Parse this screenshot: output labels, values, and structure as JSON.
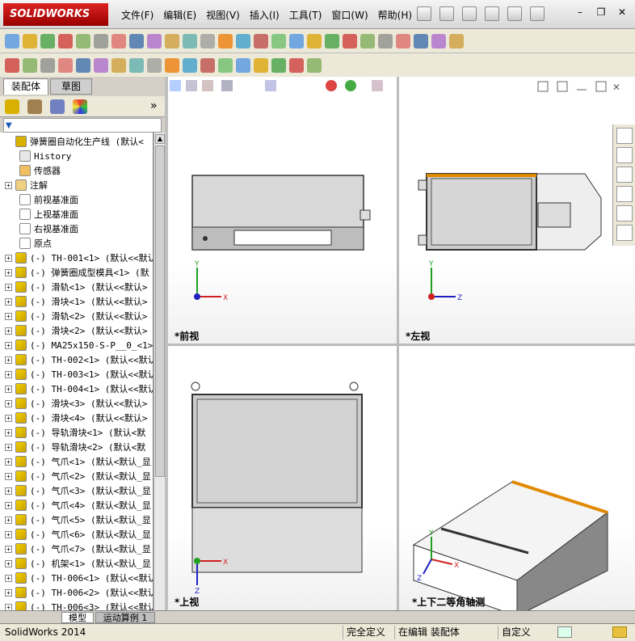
{
  "app": {
    "logo": "SOLIDWORKS"
  },
  "menu": [
    "文件(F)",
    "编辑(E)",
    "视图(V)",
    "插入(I)",
    "工具(T)",
    "窗口(W)",
    "帮助(H)"
  ],
  "feature_manager": {
    "tabs": [
      "装配体",
      "草图"
    ],
    "active_tab": "装配体",
    "tree": [
      {
        "label": "弹簧圈自动化生产线  (默认<",
        "indent": 0,
        "icon": "assembly-icon",
        "expand": false
      },
      {
        "label": "History",
        "indent": 1,
        "icon": "history-icon",
        "expand": false
      },
      {
        "label": "传感器",
        "indent": 1,
        "icon": "sensor-icon",
        "expand": false
      },
      {
        "label": "注解",
        "indent": 1,
        "icon": "annotation-icon",
        "expand": true
      },
      {
        "label": "前视基准面",
        "indent": 1,
        "icon": "plane-icon",
        "expand": false
      },
      {
        "label": "上视基准面",
        "indent": 1,
        "icon": "plane-icon",
        "expand": false
      },
      {
        "label": "右视基准面",
        "indent": 1,
        "icon": "plane-icon",
        "expand": false
      },
      {
        "label": "原点",
        "indent": 1,
        "icon": "origin-icon",
        "expand": false
      },
      {
        "label": "(-) TH-001<1> (默认<<默认",
        "indent": 0,
        "icon": "component-icon",
        "expand": true
      },
      {
        "label": "(-) 弹簧圈成型模具<1> (默",
        "indent": 0,
        "icon": "component-icon",
        "expand": true
      },
      {
        "label": "(-) 滑轨<1> (默认<<默认>",
        "indent": 0,
        "icon": "component-icon",
        "expand": true
      },
      {
        "label": "(-) 滑块<1> (默认<<默认>",
        "indent": 0,
        "icon": "component-icon",
        "expand": true
      },
      {
        "label": "(-) 滑轨<2> (默认<<默认>",
        "indent": 0,
        "icon": "component-icon",
        "expand": true
      },
      {
        "label": "(-) 滑块<2> (默认<<默认>",
        "indent": 0,
        "icon": "component-icon",
        "expand": true
      },
      {
        "label": "(-) MA25x150-S-P__0_<1>",
        "indent": 0,
        "icon": "component-icon",
        "expand": true
      },
      {
        "label": "(-) TH-002<1> (默认<<默认",
        "indent": 0,
        "icon": "component-icon",
        "expand": true
      },
      {
        "label": "(-) TH-003<1> (默认<<默认",
        "indent": 0,
        "icon": "component-icon",
        "expand": true
      },
      {
        "label": "(-) TH-004<1> (默认<<默认",
        "indent": 0,
        "icon": "component-icon",
        "expand": true
      },
      {
        "label": "(-) 滑块<3> (默认<<默认>",
        "indent": 0,
        "icon": "component-icon",
        "expand": true
      },
      {
        "label": "(-) 滑块<4> (默认<<默认>",
        "indent": 0,
        "icon": "component-icon",
        "expand": true
      },
      {
        "label": "(-) 导轨滑块<1> (默认<默",
        "indent": 0,
        "icon": "component-icon",
        "expand": true
      },
      {
        "label": "(-) 导轨滑块<2> (默认<默",
        "indent": 0,
        "icon": "component-icon",
        "expand": true
      },
      {
        "label": "(-) 气爪<1> (默认<默认_显",
        "indent": 0,
        "icon": "component-icon",
        "expand": true
      },
      {
        "label": "(-) 气爪<2> (默认<默认_显",
        "indent": 0,
        "icon": "component-icon",
        "expand": true
      },
      {
        "label": "(-) 气爪<3> (默认<默认_显",
        "indent": 0,
        "icon": "component-icon",
        "expand": true
      },
      {
        "label": "(-) 气爪<4> (默认<默认_显",
        "indent": 0,
        "icon": "component-icon",
        "expand": true
      },
      {
        "label": "(-) 气爪<5> (默认<默认_显",
        "indent": 0,
        "icon": "component-icon",
        "expand": true
      },
      {
        "label": "(-) 气爪<6> (默认<默认_显",
        "indent": 0,
        "icon": "component-icon",
        "expand": true
      },
      {
        "label": "(-) 气爪<7> (默认<默认_显",
        "indent": 0,
        "icon": "component-icon",
        "expand": true
      },
      {
        "label": "(-) 机架<1> (默认<默认_显",
        "indent": 0,
        "icon": "component-icon",
        "expand": true
      },
      {
        "label": "(-) TH-006<1> (默认<<默认",
        "indent": 0,
        "icon": "component-icon",
        "expand": true
      },
      {
        "label": "(-) TH-006<2> (默认<<默认",
        "indent": 0,
        "icon": "component-icon",
        "expand": true
      },
      {
        "label": "(-) TH-006<3> (默认<<默认",
        "indent": 0,
        "icon": "component-icon",
        "expand": true
      }
    ]
  },
  "views": {
    "front": "*前视",
    "left": "*左视",
    "top": "*上视",
    "iso": "*上下二等角轴测"
  },
  "bottom_tabs": [
    "模型",
    "运动算例 1"
  ],
  "status": {
    "app": "SolidWorks 2014",
    "fully_defined": "完全定义",
    "editing": "在编辑 装配体",
    "custom": "自定义"
  },
  "colors": {
    "accent": "#e08a00",
    "axis_x": "#d02020",
    "axis_y": "#20a020",
    "axis_z": "#2020c0"
  }
}
